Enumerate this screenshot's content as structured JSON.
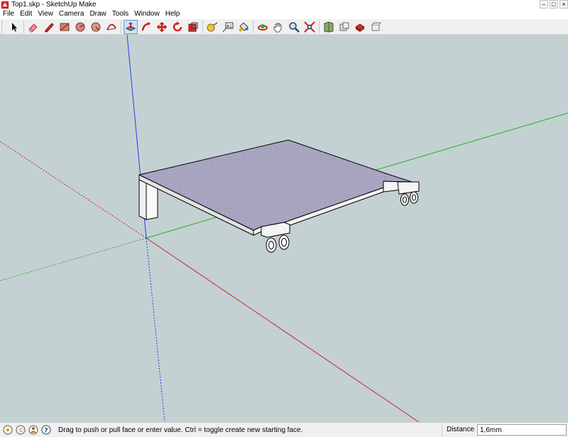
{
  "window": {
    "title": "Top1.skp - SketchUp Make"
  },
  "menu": [
    "File",
    "Edit",
    "View",
    "Camera",
    "Draw",
    "Tools",
    "Window",
    "Help"
  ],
  "toolbar": {
    "tools": [
      {
        "name": "select-tool-button",
        "icon": "arrow-icon"
      },
      {
        "name": "eraser-tool-button",
        "icon": "eraser-icon"
      },
      {
        "name": "line-tool-button",
        "icon": "pencil-icon"
      },
      {
        "name": "rectangle-tool-button",
        "icon": "rectangle-icon"
      },
      {
        "name": "circle-tool-button",
        "icon": "circle-icon"
      },
      {
        "name": "polygon-tool-button",
        "icon": "polygon-icon"
      },
      {
        "name": "arc-tool-button",
        "icon": "arc-icon"
      },
      {
        "name": "push-pull-tool-button",
        "icon": "push-pull-icon",
        "active": true
      },
      {
        "name": "follow-me-tool-button",
        "icon": "follow-me-icon"
      },
      {
        "name": "move-tool-button",
        "icon": "move-icon"
      },
      {
        "name": "rotate-tool-button",
        "icon": "rotate-icon"
      },
      {
        "name": "scale-tool-button",
        "icon": "scale-icon"
      },
      {
        "name": "tape-measure-tool-button",
        "icon": "tape-measure-icon"
      },
      {
        "name": "text-tool-button",
        "icon": "text-icon"
      },
      {
        "name": "paint-bucket-tool-button",
        "icon": "paint-bucket-icon"
      },
      {
        "name": "orbit-tool-button",
        "icon": "orbit-icon"
      },
      {
        "name": "pan-tool-button",
        "icon": "hand-icon"
      },
      {
        "name": "zoom-tool-button",
        "icon": "magnifier-icon"
      },
      {
        "name": "zoom-extents-tool-button",
        "icon": "zoom-extents-icon"
      },
      {
        "name": "3d-warehouse-button",
        "icon": "warehouse-icon"
      },
      {
        "name": "share-model-button",
        "icon": "share-model-icon"
      },
      {
        "name": "extension-warehouse-button",
        "icon": "extension-icon"
      },
      {
        "name": "components-button",
        "icon": "components-icon"
      }
    ]
  },
  "colors": {
    "viewport_bg": "#c4d1d3",
    "axis_red": "#d02020",
    "axis_green": "#20b020",
    "axis_blue": "#2040e0",
    "face_top": "#aaa8c2",
    "face_side": "#e6e6e6"
  },
  "statusbar": {
    "hint": "Drag to push or pull face or enter value.  Ctrl = toggle create new starting face.",
    "measure_label": "Distance",
    "measure_value": "1,6mm"
  }
}
